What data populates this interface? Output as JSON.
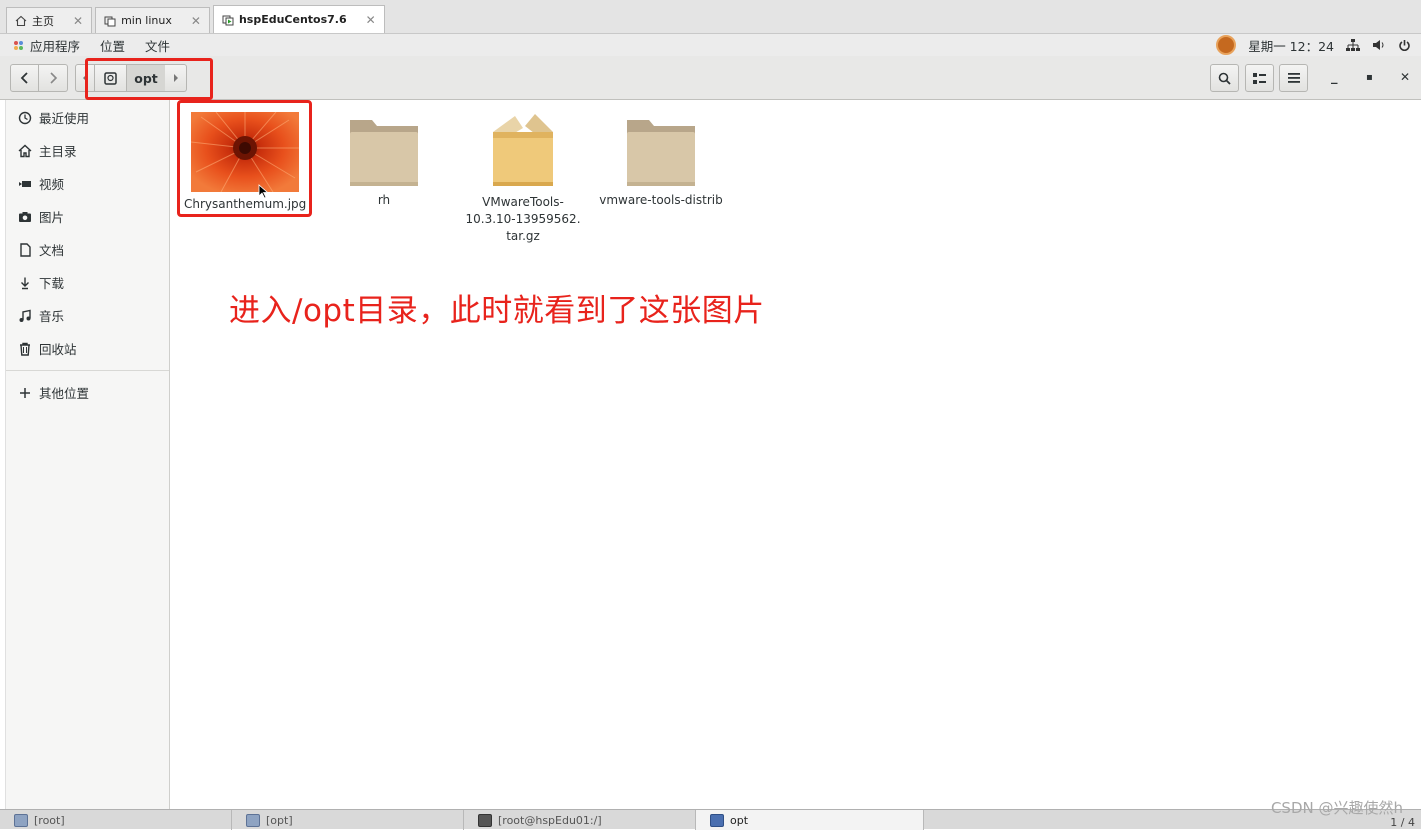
{
  "vm_tabs": [
    {
      "label": "主页",
      "active": false
    },
    {
      "label": "min linux",
      "active": false
    },
    {
      "label": "hspEduCentos7.6",
      "active": true
    }
  ],
  "topbar": {
    "apps_label": "应用程序",
    "places_label": "位置",
    "files_label": "文件",
    "clock": "星期一 12：24"
  },
  "pathbar": {
    "current": "opt"
  },
  "sidebar": {
    "items": [
      {
        "label": "最近使用",
        "icon": "clock-icon"
      },
      {
        "label": "主目录",
        "icon": "home-icon"
      },
      {
        "label": "视频",
        "icon": "video-icon"
      },
      {
        "label": "图片",
        "icon": "camera-icon"
      },
      {
        "label": "文档",
        "icon": "document-icon"
      },
      {
        "label": "下载",
        "icon": "download-icon"
      },
      {
        "label": "音乐",
        "icon": "music-icon"
      },
      {
        "label": "回收站",
        "icon": "trash-icon"
      }
    ],
    "other_locations": "其他位置"
  },
  "files": [
    {
      "name": "Chrysanthemum.jpg",
      "type": "image"
    },
    {
      "name": "rh",
      "type": "folder"
    },
    {
      "name_lines": [
        "VMwareTools-",
        "10.3.10-13959562.",
        "tar.gz"
      ],
      "type": "archive"
    },
    {
      "name": "vmware-tools-distrib",
      "type": "folder"
    }
  ],
  "annotation": "进入/opt目录，此时就看到了这张图片",
  "taskbar": [
    {
      "label": "[root]"
    },
    {
      "label": "[opt]"
    },
    {
      "label": "[root@hspEdu01:/]"
    },
    {
      "label": "opt"
    }
  ],
  "watermark": "CSDN @兴趣使然h",
  "pager": "1 / 4",
  "colors": {
    "highlight": "#e8231c",
    "folder": "#d8c7a8",
    "archive": "#efc97a"
  }
}
